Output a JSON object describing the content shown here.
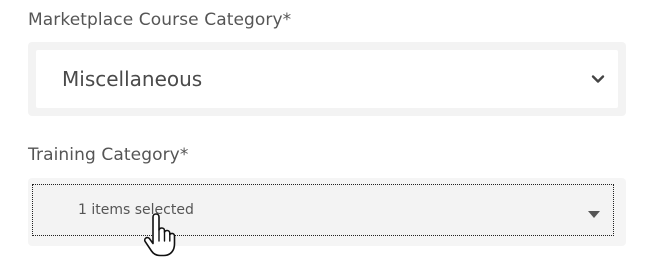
{
  "marketplace": {
    "label": "Marketplace Course Category*",
    "selected": "Miscellaneous"
  },
  "training": {
    "label": "Training Category*",
    "selected": "1 items selected"
  },
  "icons": {
    "dropdown": "chevron-down-icon",
    "caret": "caret-down-icon",
    "cursor": "hand-pointer-cursor-icon"
  }
}
